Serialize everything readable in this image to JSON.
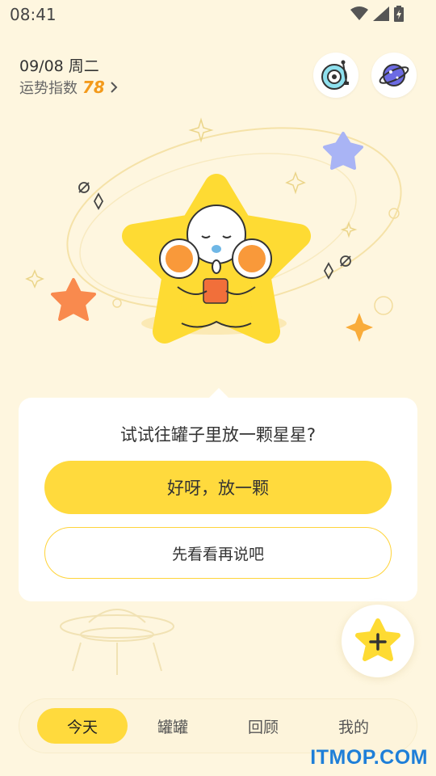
{
  "status_bar": {
    "time": "08:41"
  },
  "header": {
    "date": "09/08 周二",
    "fortune_label": "运势指数",
    "fortune_value": "78"
  },
  "icons": {
    "music": "music-disc-icon",
    "planet": "planet-icon",
    "chevron": "chevron-right-icon"
  },
  "dialog": {
    "question": "试试往罐子里放一颗星星?",
    "primary": "好呀，放一颗",
    "secondary": "先看看再说吧"
  },
  "tabs": [
    {
      "label": "今天",
      "active": true
    },
    {
      "label": "罐罐",
      "active": false
    },
    {
      "label": "回顾",
      "active": false
    },
    {
      "label": "我的",
      "active": false
    }
  ],
  "watermark": "ITMOP.COM",
  "colors": {
    "background": "#FEF6DF",
    "accent_yellow": "#FFDA3D",
    "fortune_orange": "#F39A1B",
    "star_purple": "#A9B4F5",
    "star_orange": "#F98A4E"
  }
}
